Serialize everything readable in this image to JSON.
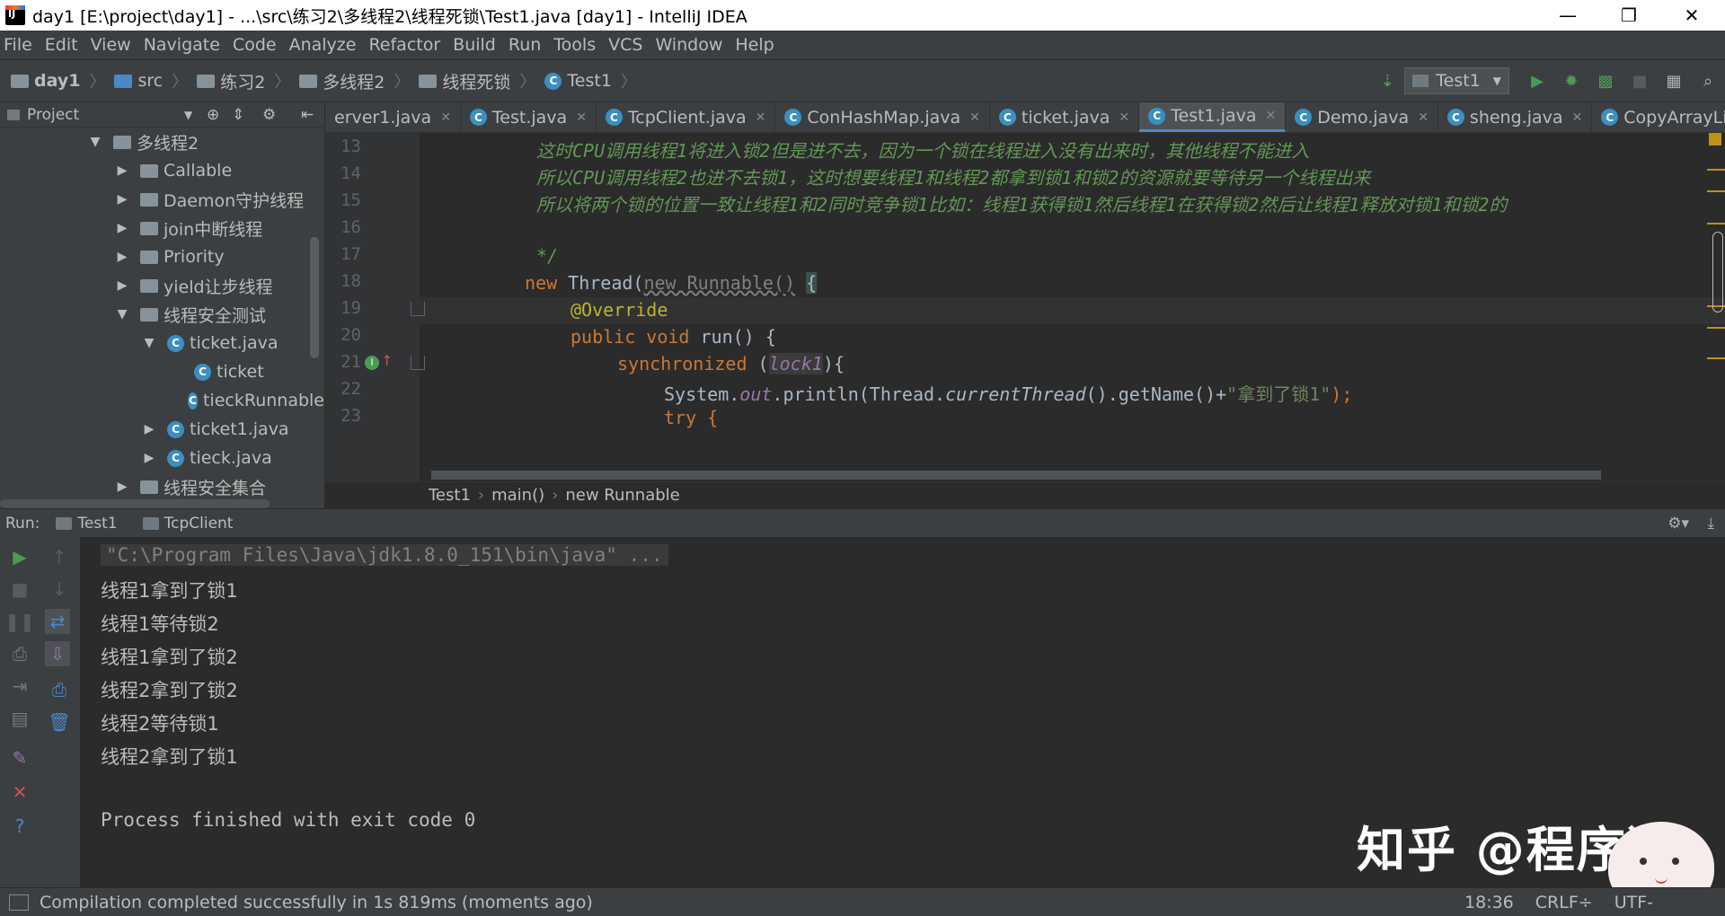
{
  "window": {
    "title": "day1 [E:\\project\\day1] - ...\\src\\练习2\\多线程2\\线程死锁\\Test1.java [day1] - IntelliJ IDEA",
    "controls": {
      "minimize": "—",
      "restore": "❐",
      "close": "✕"
    }
  },
  "menu": [
    "File",
    "Edit",
    "View",
    "Navigate",
    "Code",
    "Analyze",
    "Refactor",
    "Build",
    "Run",
    "Tools",
    "VCS",
    "Window",
    "Help"
  ],
  "navbar": {
    "crumbs": [
      "day1",
      "src",
      "练习2",
      "多线程2",
      "线程死锁",
      "Test1"
    ],
    "run_config": "Test1"
  },
  "project": {
    "header": "Project",
    "tree": [
      {
        "label": "多线程2",
        "level": 0,
        "arrow": "▼",
        "icon": "folder"
      },
      {
        "label": "Callable",
        "level": 1,
        "arrow": "▶",
        "icon": "folder"
      },
      {
        "label": "Daemon守护线程",
        "level": 1,
        "arrow": "▶",
        "icon": "folder"
      },
      {
        "label": "join中断线程",
        "level": 1,
        "arrow": "▶",
        "icon": "folder"
      },
      {
        "label": "Priority",
        "level": 1,
        "arrow": "▶",
        "icon": "folder"
      },
      {
        "label": "yield让步线程",
        "level": 1,
        "arrow": "▶",
        "icon": "folder"
      },
      {
        "label": "线程安全测试",
        "level": 1,
        "arrow": "▼",
        "icon": "folder"
      },
      {
        "label": "ticket.java",
        "level": 2,
        "arrow": "▼",
        "icon": "class"
      },
      {
        "label": "ticket",
        "level": 3,
        "arrow": "",
        "icon": "class"
      },
      {
        "label": "tieckRunnable",
        "level": 3,
        "arrow": "",
        "icon": "class"
      },
      {
        "label": "ticket1.java",
        "level": 2,
        "arrow": "▶",
        "icon": "class"
      },
      {
        "label": "tieck.java",
        "level": 2,
        "arrow": "▶",
        "icon": "class"
      },
      {
        "label": "线程安全集合",
        "level": 1,
        "arrow": "▶",
        "icon": "folder"
      }
    ]
  },
  "tabs": [
    {
      "label": "erver1.java",
      "active": false
    },
    {
      "label": "Test.java",
      "active": false
    },
    {
      "label": "TcpClient.java",
      "active": false
    },
    {
      "label": "ConHashMap.java",
      "active": false
    },
    {
      "label": "ticket.java",
      "active": false
    },
    {
      "label": "Test1.java",
      "active": true
    },
    {
      "label": "Demo.java",
      "active": false
    },
    {
      "label": "sheng.java",
      "active": false
    },
    {
      "label": "CopyArrayList.java",
      "active": false
    }
  ],
  "editor": {
    "line_numbers": [
      "13",
      "14",
      "15",
      "16",
      "17",
      "18",
      "19",
      "20",
      "21",
      "22",
      "23"
    ],
    "comment_13": "这时CPU调用线程1将进入锁2但是进不去，因为一个锁在线程进入没有出来时，其他线程不能进入",
    "comment_14": "所以CPU调用线程2也进不去锁1，这时想要线程1和线程2都拿到锁1和锁2的资源就要等待另一个线程出来",
    "comment_15": "所以将两个锁的位置一致让线程1和2同时竞争锁1比如：线程1获得锁1然后线程1在获得锁2然后让线程1释放对锁1和锁2的",
    "comment_17": "*/",
    "l18_new": "new",
    "l18_thread": "Thread(",
    "l18_runnable": "new Runnable()",
    "l18_brace": "{",
    "l19": "@Override",
    "l20_kw": "public void",
    "l20_rest": "run() {",
    "l21_kw": "synchronized",
    "l21_open": "(",
    "l21_lock": "lock1",
    "l21_close": "){",
    "l22_a": "System.",
    "l22_out": "out",
    "l22_b": ".println(Thread.",
    "l22_ct": "currentThread",
    "l22_c": "().getName()+",
    "l22_str": "\"拿到了锁1\"",
    "l22_d": ");",
    "l23": "try {"
  },
  "breadcrumb": [
    "Test1",
    "main()",
    "new Runnable"
  ],
  "run": {
    "label": "Run:",
    "tabs": [
      "Test1",
      "TcpClient"
    ],
    "console": [
      "\"C:\\Program Files\\Java\\jdk1.8.0_151\\bin\\java\" ...",
      "线程1拿到了锁1",
      "线程1等待锁2",
      "线程1拿到了锁2",
      "线程2拿到了锁2",
      "线程2等待锁1",
      "线程2拿到了锁1",
      "",
      "Process finished with exit code 0"
    ]
  },
  "status": {
    "message": "Compilation completed successfully in 1s 819ms (moments ago)",
    "position": "18:36",
    "line_sep": "CRLF÷",
    "encoding": "UTF-"
  },
  "watermark": "知乎 @程序猿",
  "colors": {
    "accent": "#4a88c7",
    "comment": "#629755",
    "keyword": "#cc7832",
    "run_green": "#499c54",
    "stop_red": "#c75450"
  }
}
